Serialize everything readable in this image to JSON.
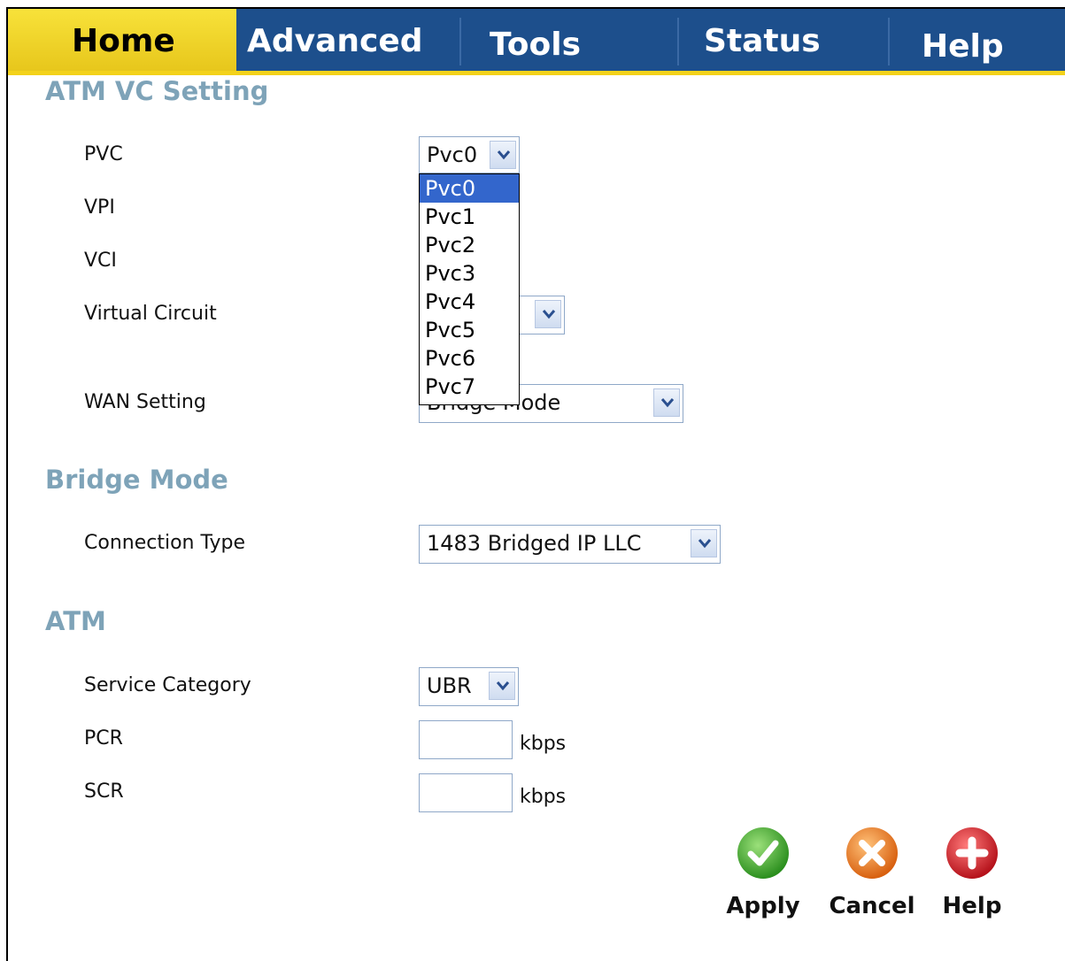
{
  "tabs": [
    "Home",
    "Advanced",
    "Tools",
    "Status",
    "Help"
  ],
  "active_tab": "Home",
  "sections": {
    "atm_vc": "ATM VC Setting",
    "bridge": "Bridge Mode",
    "atm": "ATM"
  },
  "fields": {
    "pvc_label": "PVC",
    "pvc_value": "Pvc0",
    "vpi_label": "VPI",
    "vci_label": "VCI",
    "virtual_circuit_label": "Virtual Circuit",
    "wan_label": "WAN Setting",
    "wan_value": "Bridge Mode",
    "connection_type_label": "Connection Type",
    "connection_type_value": "1483 Bridged IP LLC",
    "service_category_label": "Service Category",
    "service_category_value": "UBR",
    "pcr_label": "PCR",
    "pcr_unit": "kbps",
    "scr_label": "SCR",
    "scr_unit": "kbps"
  },
  "pvc_options": [
    "Pvc0",
    "Pvc1",
    "Pvc2",
    "Pvc3",
    "Pvc4",
    "Pvc5",
    "Pvc6",
    "Pvc7"
  ],
  "actions": {
    "apply": "Apply",
    "cancel": "Cancel",
    "help": "Help"
  },
  "icons": {
    "apply": "check-icon",
    "cancel": "x-icon",
    "help": "plus-icon"
  },
  "colors": {
    "tab_bar": "#1d4f8c",
    "tab_active": "#f3d21b",
    "section_title": "#7ea3b8",
    "apply": "#3aa52c",
    "cancel": "#e2761c",
    "help": "#d0202a"
  }
}
